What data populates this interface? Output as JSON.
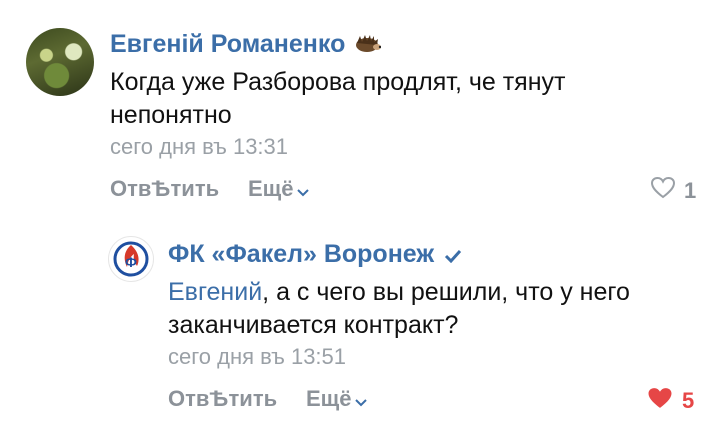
{
  "comment": {
    "author": "Евгеній Романенко",
    "author_badge_icon": "hedgehog-icon",
    "text_line1": "Когда уже Разборова продлят, че тянут",
    "text_line2": "непонятно",
    "timestamp": "сего дня въ 13:31",
    "reply_label": "ОтвѢтить",
    "more_label": "Ещё",
    "likes": "1",
    "liked": false
  },
  "reply": {
    "author": "ФК «Факел» Воронеж",
    "verified_icon": "check-icon",
    "mention": "Евгений",
    "text_line1_rest": ", а с чего вы решили, что у него",
    "text_line2": "заканчивается контракт?",
    "timestamp": "сего дня въ 13:51",
    "reply_label": "ОтвѢтить",
    "more_label": "Ещё",
    "likes": "5",
    "liked": true
  },
  "colors": {
    "link": "#3b6ea8",
    "meta": "#9aa0a6",
    "like_active": "#e64646"
  }
}
